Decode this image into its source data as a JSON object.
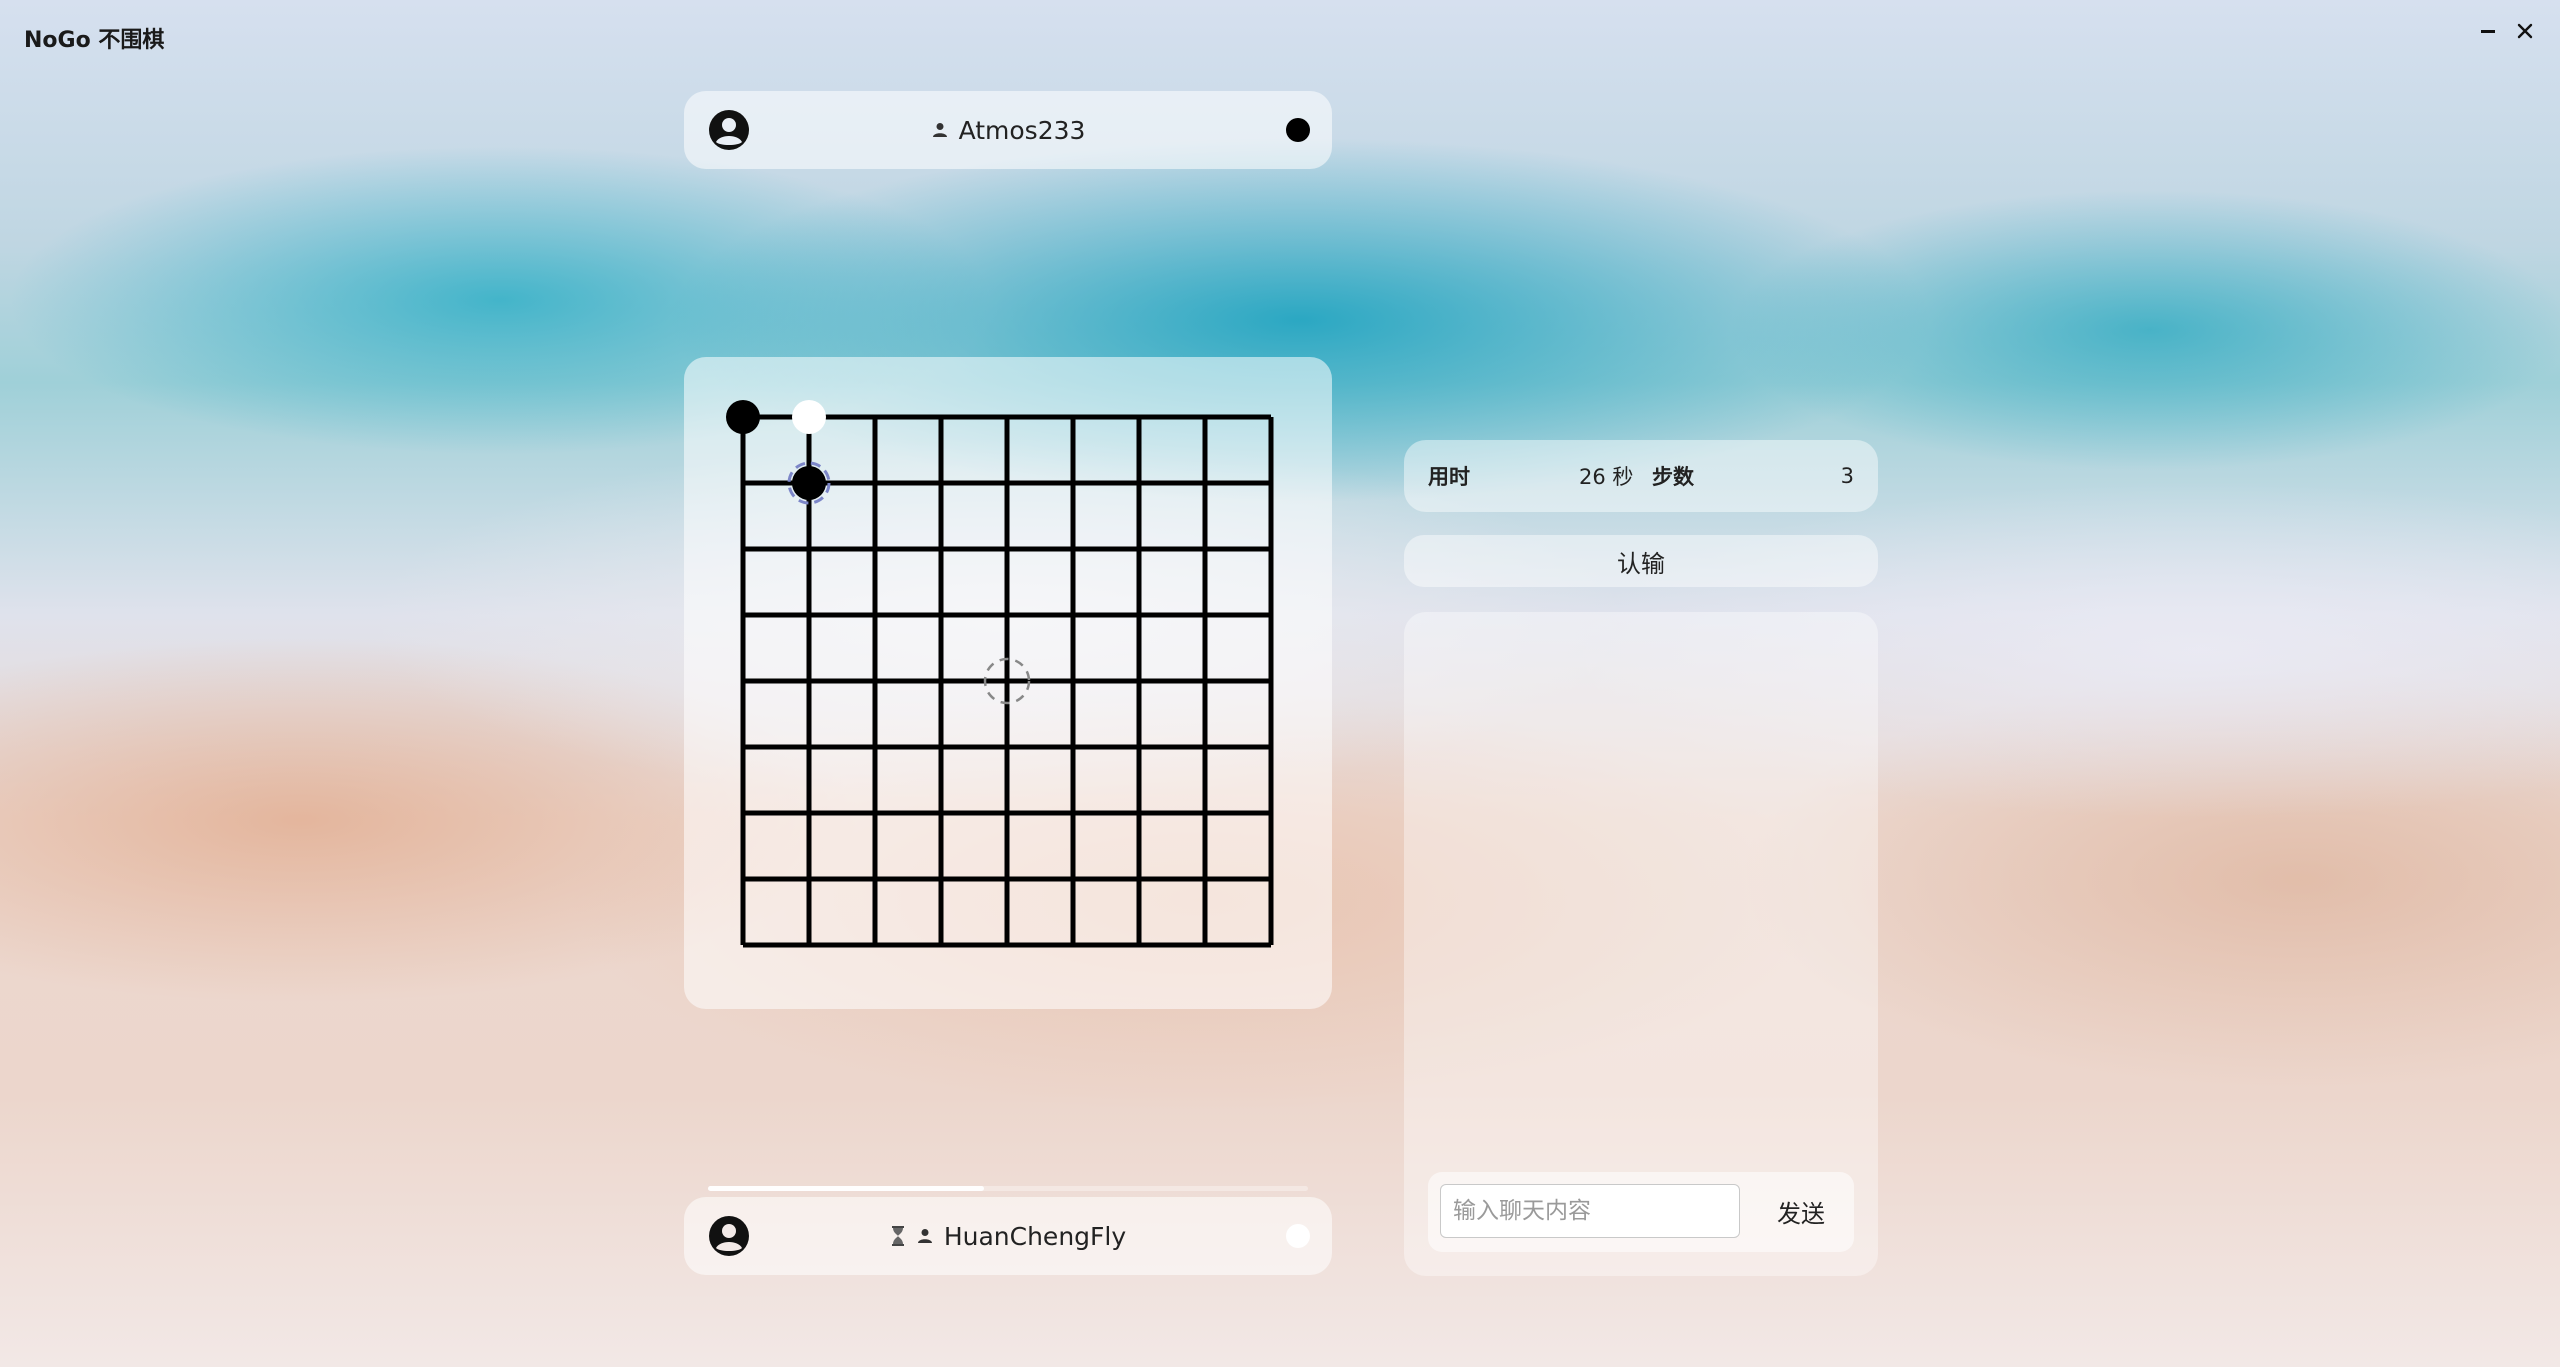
{
  "app": {
    "title": "NoGo 不围棋"
  },
  "window_controls": {
    "minimize_icon": "minimize-icon",
    "close_icon": "close-icon"
  },
  "players": {
    "top": {
      "name": "Atmos233",
      "stone": "black"
    },
    "bottom": {
      "name": "HuanChengFly",
      "stone": "white",
      "waiting": true
    }
  },
  "board": {
    "size": 9,
    "stones": [
      {
        "row": 0,
        "col": 0,
        "color": "black"
      },
      {
        "row": 0,
        "col": 1,
        "color": "white"
      },
      {
        "row": 1,
        "col": 1,
        "color": "black",
        "last_move": true
      }
    ],
    "hover": {
      "row": 4,
      "col": 4
    }
  },
  "turn_progress": 0.46,
  "info": {
    "time_label": "用时",
    "time_value": "26 秒",
    "steps_label": "步数",
    "steps_value": "3"
  },
  "resign_label": "认输",
  "chat": {
    "messages": [],
    "input_placeholder": "输入聊天内容",
    "input_value": "",
    "send_label": "发送"
  }
}
